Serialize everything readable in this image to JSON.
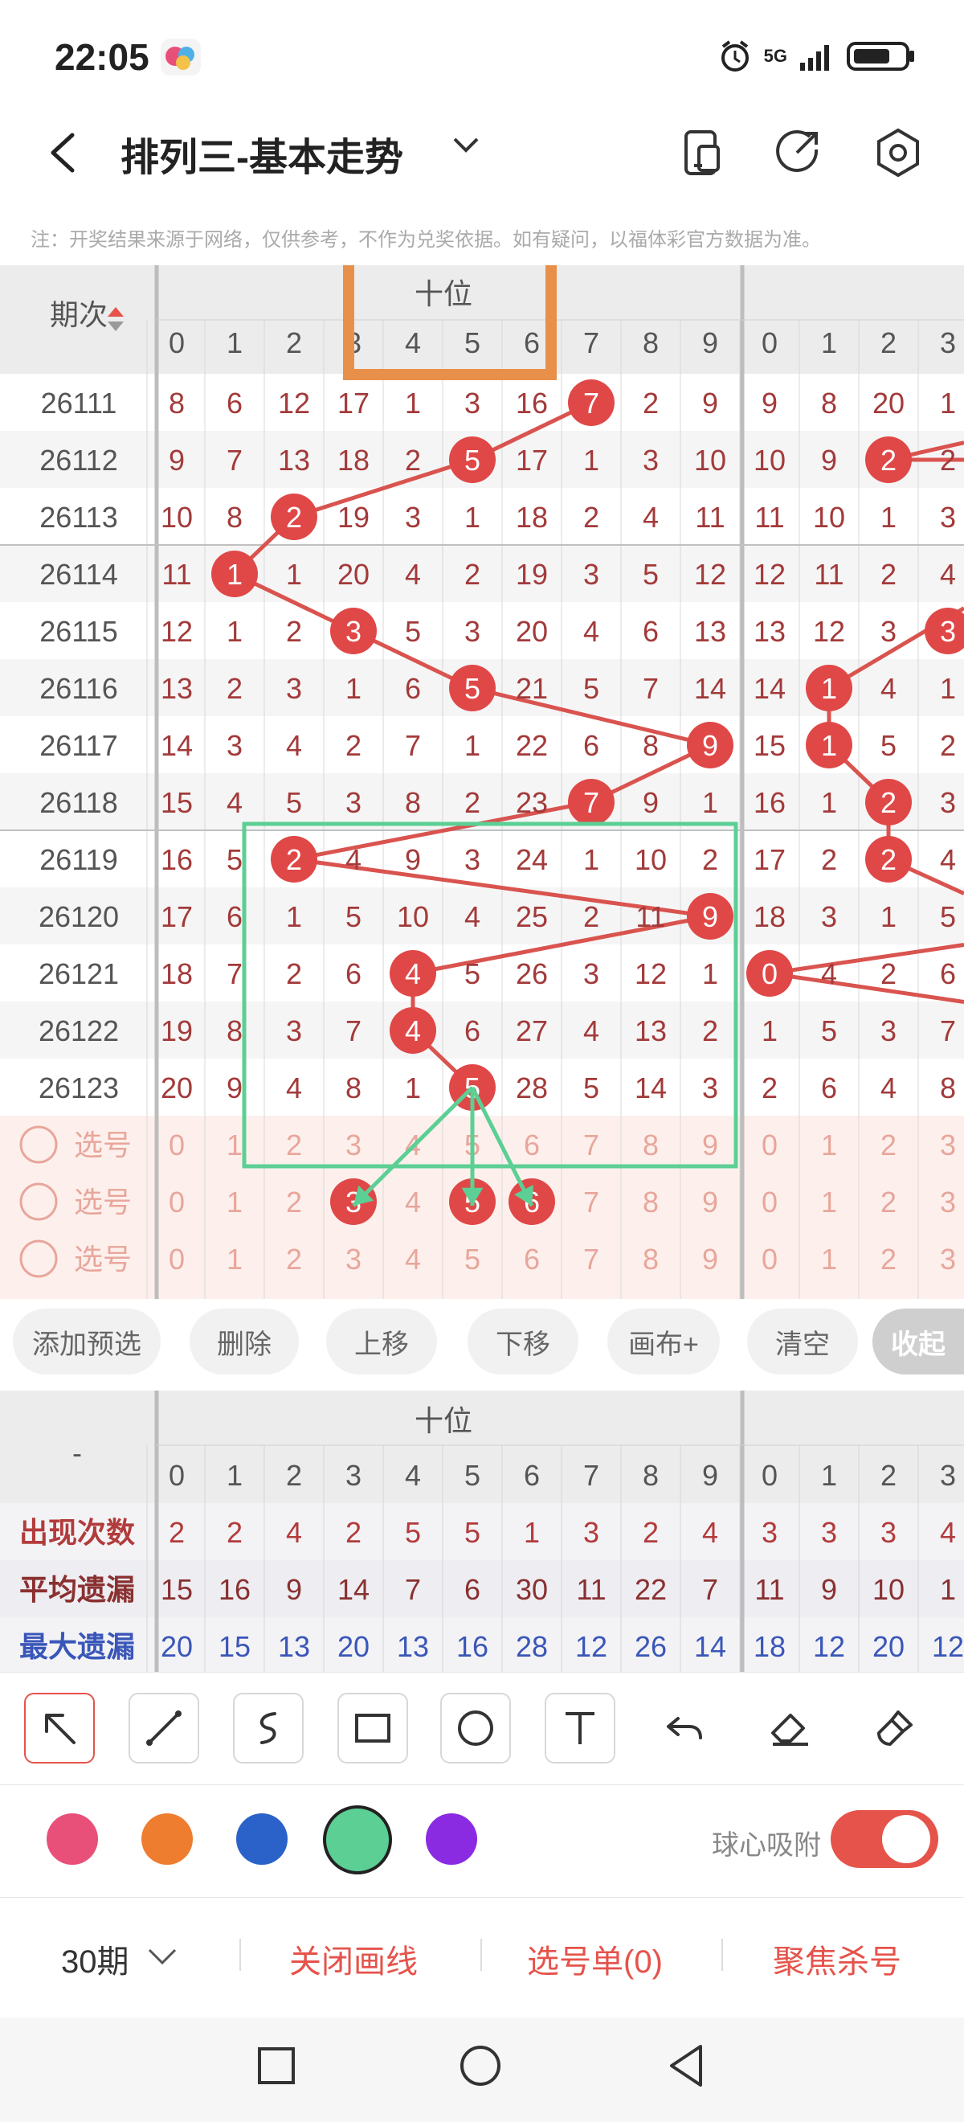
{
  "status_bar": {
    "time": "22:05",
    "network": "5G"
  },
  "header": {
    "title": "排列三-基本走势",
    "notice": "注：开奖结果来源于网络，仅供参考，不作为兑奖依据。如有疑问，以福体彩官方数据为准。"
  },
  "grid": {
    "period_header": "期次",
    "section_label": "十位",
    "digits": [
      "0",
      "1",
      "2",
      "3",
      "4",
      "5",
      "6",
      "7",
      "8",
      "9"
    ],
    "right_digits": [
      "0",
      "1",
      "2",
      "3"
    ],
    "rows": [
      {
        "period": "26111",
        "cells": [
          "8",
          "6",
          "12",
          "17",
          "1",
          "3",
          "16",
          "7",
          "2",
          "9"
        ],
        "right": [
          "9",
          "8",
          "20",
          "1"
        ],
        "hit": 7,
        "right_hit": null
      },
      {
        "period": "26112",
        "cells": [
          "9",
          "7",
          "13",
          "18",
          "2",
          "5",
          "17",
          "1",
          "3",
          "10"
        ],
        "right": [
          "10",
          "9",
          "2",
          "2"
        ],
        "hit": 5,
        "right_hit": 2
      },
      {
        "period": "26113",
        "cells": [
          "10",
          "8",
          "2",
          "19",
          "3",
          "1",
          "18",
          "2",
          "4",
          "11"
        ],
        "right": [
          "11",
          "10",
          "1",
          "3"
        ],
        "hit": 2,
        "right_hit": null
      },
      {
        "period": "26114",
        "cells": [
          "11",
          "1",
          "1",
          "20",
          "4",
          "2",
          "19",
          "3",
          "5",
          "12"
        ],
        "right": [
          "12",
          "11",
          "2",
          "4"
        ],
        "hit": 1,
        "right_hit": null
      },
      {
        "period": "26115",
        "cells": [
          "12",
          "1",
          "2",
          "3",
          "5",
          "3",
          "20",
          "4",
          "6",
          "13"
        ],
        "right": [
          "13",
          "12",
          "3",
          "3"
        ],
        "hit": 3,
        "right_hit": 3
      },
      {
        "period": "26116",
        "cells": [
          "13",
          "2",
          "3",
          "1",
          "6",
          "5",
          "21",
          "5",
          "7",
          "14"
        ],
        "right": [
          "14",
          "1",
          "4",
          "1"
        ],
        "hit": 5,
        "right_hit": 1
      },
      {
        "period": "26117",
        "cells": [
          "14",
          "3",
          "4",
          "2",
          "7",
          "1",
          "22",
          "6",
          "8",
          "9"
        ],
        "right": [
          "15",
          "1",
          "5",
          "2"
        ],
        "hit": 9,
        "right_hit": 1
      },
      {
        "period": "26118",
        "cells": [
          "15",
          "4",
          "5",
          "3",
          "8",
          "2",
          "23",
          "7",
          "9",
          "1"
        ],
        "right": [
          "16",
          "1",
          "2",
          "3"
        ],
        "hit": 7,
        "right_hit": 2
      },
      {
        "period": "26119",
        "cells": [
          "16",
          "5",
          "2",
          "4",
          "9",
          "3",
          "24",
          "1",
          "10",
          "2"
        ],
        "right": [
          "17",
          "2",
          "2",
          "4"
        ],
        "hit": 2,
        "right_hit": 2
      },
      {
        "period": "26120",
        "cells": [
          "17",
          "6",
          "1",
          "5",
          "10",
          "4",
          "25",
          "2",
          "11",
          "9"
        ],
        "right": [
          "18",
          "3",
          "1",
          "5"
        ],
        "hit": 9,
        "right_hit": null
      },
      {
        "period": "26121",
        "cells": [
          "18",
          "7",
          "2",
          "6",
          "4",
          "5",
          "26",
          "3",
          "12",
          "1"
        ],
        "right": [
          "0",
          "4",
          "2",
          "6"
        ],
        "hit": 4,
        "right_hit": 0
      },
      {
        "period": "26122",
        "cells": [
          "19",
          "8",
          "3",
          "7",
          "4",
          "6",
          "27",
          "4",
          "13",
          "2"
        ],
        "right": [
          "1",
          "5",
          "3",
          "7"
        ],
        "hit": 4,
        "right_hit": null
      },
      {
        "period": "26123",
        "cells": [
          "20",
          "9",
          "4",
          "8",
          "1",
          "5",
          "28",
          "5",
          "14",
          "3"
        ],
        "right": [
          "2",
          "6",
          "4",
          "8"
        ],
        "hit": 5,
        "right_hit": null
      }
    ],
    "pick_label": "选号",
    "pick_rows": [
      {
        "selected": []
      },
      {
        "selected": [
          3,
          5,
          6
        ]
      },
      {
        "selected": []
      }
    ]
  },
  "toolbar": {
    "buttons": [
      "添加预选",
      "删除",
      "上移",
      "下移",
      "画布+",
      "清空",
      "收起"
    ]
  },
  "stats": {
    "corner": "-",
    "section_label": "十位",
    "rows": [
      {
        "label": "出现次数",
        "values": [
          "2",
          "2",
          "4",
          "2",
          "5",
          "5",
          "1",
          "3",
          "2",
          "4"
        ],
        "right": [
          "3",
          "3",
          "3",
          "4"
        ],
        "color": "#b23b3b"
      },
      {
        "label": "平均遗漏",
        "values": [
          "15",
          "16",
          "9",
          "14",
          "7",
          "6",
          "30",
          "11",
          "22",
          "7"
        ],
        "right": [
          "11",
          "9",
          "10",
          "1"
        ],
        "color": "#8a3030"
      },
      {
        "label": "最大遗漏",
        "values": [
          "20",
          "15",
          "13",
          "20",
          "13",
          "16",
          "28",
          "12",
          "26",
          "14"
        ],
        "right": [
          "18",
          "12",
          "20",
          "12"
        ],
        "color": "#3a56b8"
      }
    ]
  },
  "draw_tools": [
    "arrow-tool",
    "line-tool",
    "freehand-tool",
    "rectangle-tool",
    "circle-tool",
    "text-tool",
    "undo",
    "eraser",
    "brush-clear"
  ],
  "colors": [
    "#e8507a",
    "#ee7d30",
    "#2b62c9",
    "#5ccf94",
    "#8a2be2"
  ],
  "snap_label": "球心吸附",
  "bottom_bar": {
    "periods": "30期",
    "close_lines": "关闭画线",
    "pick_list": "选号单(0)",
    "focus_kill": "聚焦杀号"
  },
  "theme": {
    "accent": "#e5534b",
    "ball": "#e04848",
    "line": "#d9534f",
    "annot_orange": "#e8904a",
    "annot_green": "#5ccf94"
  }
}
